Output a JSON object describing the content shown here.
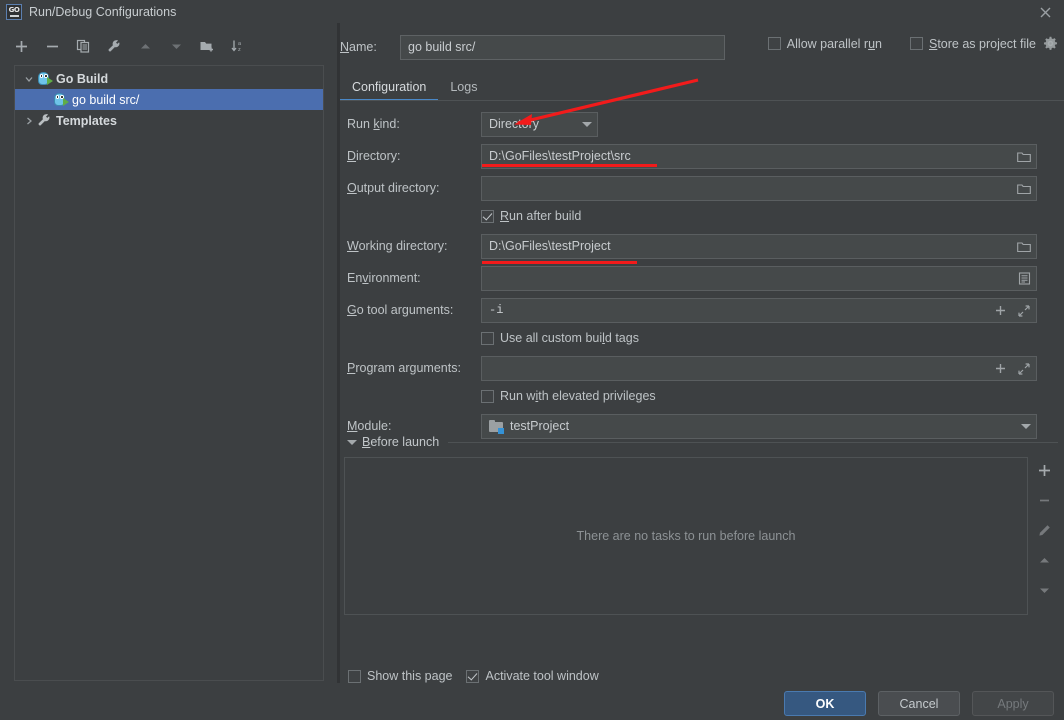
{
  "window": {
    "title": "Run/Debug Configurations",
    "app_icon": "go-logo-icon",
    "close_icon": "close-icon"
  },
  "sidebar": {
    "toolbar": [
      {
        "name": "add-configuration-button",
        "icon": "plus-icon",
        "enabled": true
      },
      {
        "name": "remove-configuration-button",
        "icon": "minus-icon",
        "enabled": true
      },
      {
        "name": "copy-configuration-button",
        "icon": "copy-icon",
        "enabled": true
      },
      {
        "name": "edit-templates-button",
        "icon": "wrench-icon",
        "enabled": true
      },
      {
        "name": "move-up-button",
        "icon": "arrow-up-icon",
        "enabled": false
      },
      {
        "name": "move-down-button",
        "icon": "arrow-down-icon",
        "enabled": false
      },
      {
        "name": "move-into-folder-button",
        "icon": "folder-add-icon",
        "enabled": true
      },
      {
        "name": "sort-configurations-button",
        "icon": "sort-az-icon",
        "enabled": true
      }
    ],
    "tree": [
      {
        "label": "Go Build",
        "icon": "go-run-icon",
        "expanded": true,
        "level": 0,
        "selected": false,
        "bold": true
      },
      {
        "label": "go build src/",
        "icon": "go-run-icon",
        "level": 1,
        "selected": true,
        "bold": false
      },
      {
        "label": "Templates",
        "icon": "wrench-icon",
        "expanded": false,
        "level": 0,
        "selected": false,
        "bold": true
      }
    ],
    "help_label": "?"
  },
  "header": {
    "name_label": "Name:",
    "name_mnemonic": "N",
    "name_value": "go build src/",
    "name_placeholder": "",
    "allow_parallel_run": {
      "label_pre": "Allow parallel r",
      "mnemonic": "u",
      "label_post": "n",
      "checked": false
    },
    "store_as_project_file": {
      "mnemonic": "S",
      "label_post": "tore as project file",
      "checked": false
    },
    "store_gear_icon": "gear-icon"
  },
  "tabs": [
    {
      "label": "Configuration",
      "active": true
    },
    {
      "label": "Logs",
      "active": false
    }
  ],
  "form": {
    "run_kind": {
      "label_pre": "Run ",
      "mnemonic": "k",
      "label_post": "ind:",
      "value": "Directory",
      "arrow_icon": "chevron-down-icon"
    },
    "directory": {
      "mnemonic": "D",
      "label_post": "irectory:",
      "value": "D:\\GoFiles\\testProject\\src",
      "browse_icon": "folder-icon"
    },
    "output_directory": {
      "mnemonic": "O",
      "label_post": "utput directory:",
      "value": "",
      "browse_icon": "folder-icon"
    },
    "run_after_build": {
      "mnemonic": "R",
      "label_post": "un after build",
      "checked": true
    },
    "working_directory": {
      "mnemonic": "W",
      "label_post": "orking directory:",
      "value": "D:\\GoFiles\\testProject",
      "browse_icon": "folder-icon"
    },
    "environment": {
      "label_pre": "En",
      "mnemonic": "v",
      "label_post": "ironment:",
      "value": "",
      "edit_icon": "list-edit-icon"
    },
    "go_tool_arguments": {
      "mnemonic": "G",
      "label_post": "o tool arguments:",
      "value": "-i",
      "insert_icon": "plus-icon",
      "expand_icon": "expand-icon"
    },
    "use_all_custom_build_tags": {
      "label_pre": "Use all custom bui",
      "mnemonic": "l",
      "label_post": "d tags",
      "checked": false
    },
    "program_arguments": {
      "mnemonic": "P",
      "label_post": "rogram arguments:",
      "value": "",
      "insert_icon": "plus-icon",
      "expand_icon": "expand-icon"
    },
    "run_with_elevated_privileges": {
      "label_pre": "Run w",
      "mnemonic": "i",
      "label_post": "th elevated privileges",
      "checked": false
    },
    "module": {
      "mnemonic": "M",
      "label_post": "odule:",
      "value": "testProject",
      "icon": "module-folder-icon",
      "arrow_icon": "chevron-down-icon"
    }
  },
  "before_launch": {
    "mnemonic": "B",
    "title_post": "efore launch",
    "expanded": true,
    "twisty_icon": "chevron-down-icon",
    "empty_text": "There are no tasks to run before launch",
    "tools": [
      {
        "name": "add-task-button",
        "icon": "plus-icon",
        "enabled": true
      },
      {
        "name": "remove-task-button",
        "icon": "minus-icon",
        "enabled": false
      },
      {
        "name": "edit-task-button",
        "icon": "pencil-icon",
        "enabled": false
      },
      {
        "name": "move-task-up-button",
        "icon": "arrow-up-icon",
        "enabled": false
      },
      {
        "name": "move-task-down-button",
        "icon": "arrow-down-icon",
        "enabled": false
      }
    ]
  },
  "bottom_options": {
    "show_this_page": {
      "label": "Show this page",
      "checked": false
    },
    "activate_tool_window": {
      "label": "Activate tool window",
      "checked": true
    }
  },
  "buttons": {
    "ok": "OK",
    "cancel": "Cancel",
    "apply": "Apply",
    "apply_enabled": false
  },
  "colors": {
    "background": "#3c3f41",
    "field_background": "#45494a",
    "selection": "#4b6eaf",
    "accent": "#4a88c7",
    "primary_button": "#365880",
    "annotation_red": "#f21b1b"
  }
}
